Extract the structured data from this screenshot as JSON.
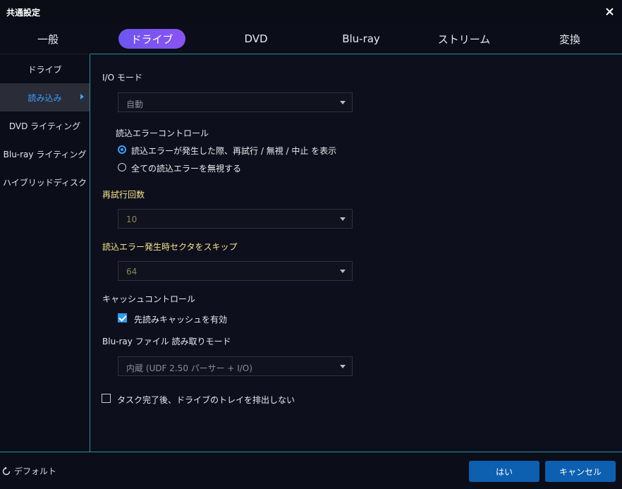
{
  "window": {
    "title": "共通設定"
  },
  "tabs": [
    {
      "label": "一般"
    },
    {
      "label": "ドライブ"
    },
    {
      "label": "DVD"
    },
    {
      "label": "Blu-ray"
    },
    {
      "label": "ストリーム"
    },
    {
      "label": "変換"
    }
  ],
  "sidebar": {
    "items": [
      {
        "label": "ドライブ"
      },
      {
        "label": "読み込み"
      },
      {
        "label": "DVD ライティング"
      },
      {
        "label": "Blu-ray ライティング"
      },
      {
        "label": "ハイブリッドディスク"
      }
    ]
  },
  "settings": {
    "io_mode": {
      "label": "I/O モード",
      "value": "自動"
    },
    "read_error_control": {
      "label": "読込エラーコントロール",
      "options": [
        {
          "label": "読込エラーが発生した際、再試行 / 無視 / 中止 を表示",
          "checked": true
        },
        {
          "label": "全ての読込エラーを無視する",
          "checked": false
        }
      ]
    },
    "retry_count": {
      "label": "再試行回数",
      "value": "10"
    },
    "skip_sectors": {
      "label": "読込エラー発生時セクタをスキップ",
      "value": "64"
    },
    "cache_control": {
      "label": "キャッシュコントロール",
      "prefetch": {
        "label": "先読みキャッシュを有効",
        "checked": true
      }
    },
    "bluray_read_mode": {
      "label": "Blu-ray ファイル 読み取りモード",
      "value": "内蔵 (UDF 2.50 パーサー + I/O)"
    },
    "no_eject": {
      "label": "タスク完了後、ドライブのトレイを排出しない",
      "checked": false
    }
  },
  "footer": {
    "default_label": "デフォルト",
    "ok_label": "はい",
    "cancel_label": "キャンセル"
  },
  "icons": {
    "close": "close-icon",
    "reset": "reset-icon"
  },
  "colors": {
    "accent": "#3aa2ff",
    "tab_active_start": "#6d55f0",
    "tab_active_end": "#8a53f3",
    "divider": "#1e9aa0",
    "highlight_label": "#f6e58a",
    "button": "#0d5fb0"
  }
}
